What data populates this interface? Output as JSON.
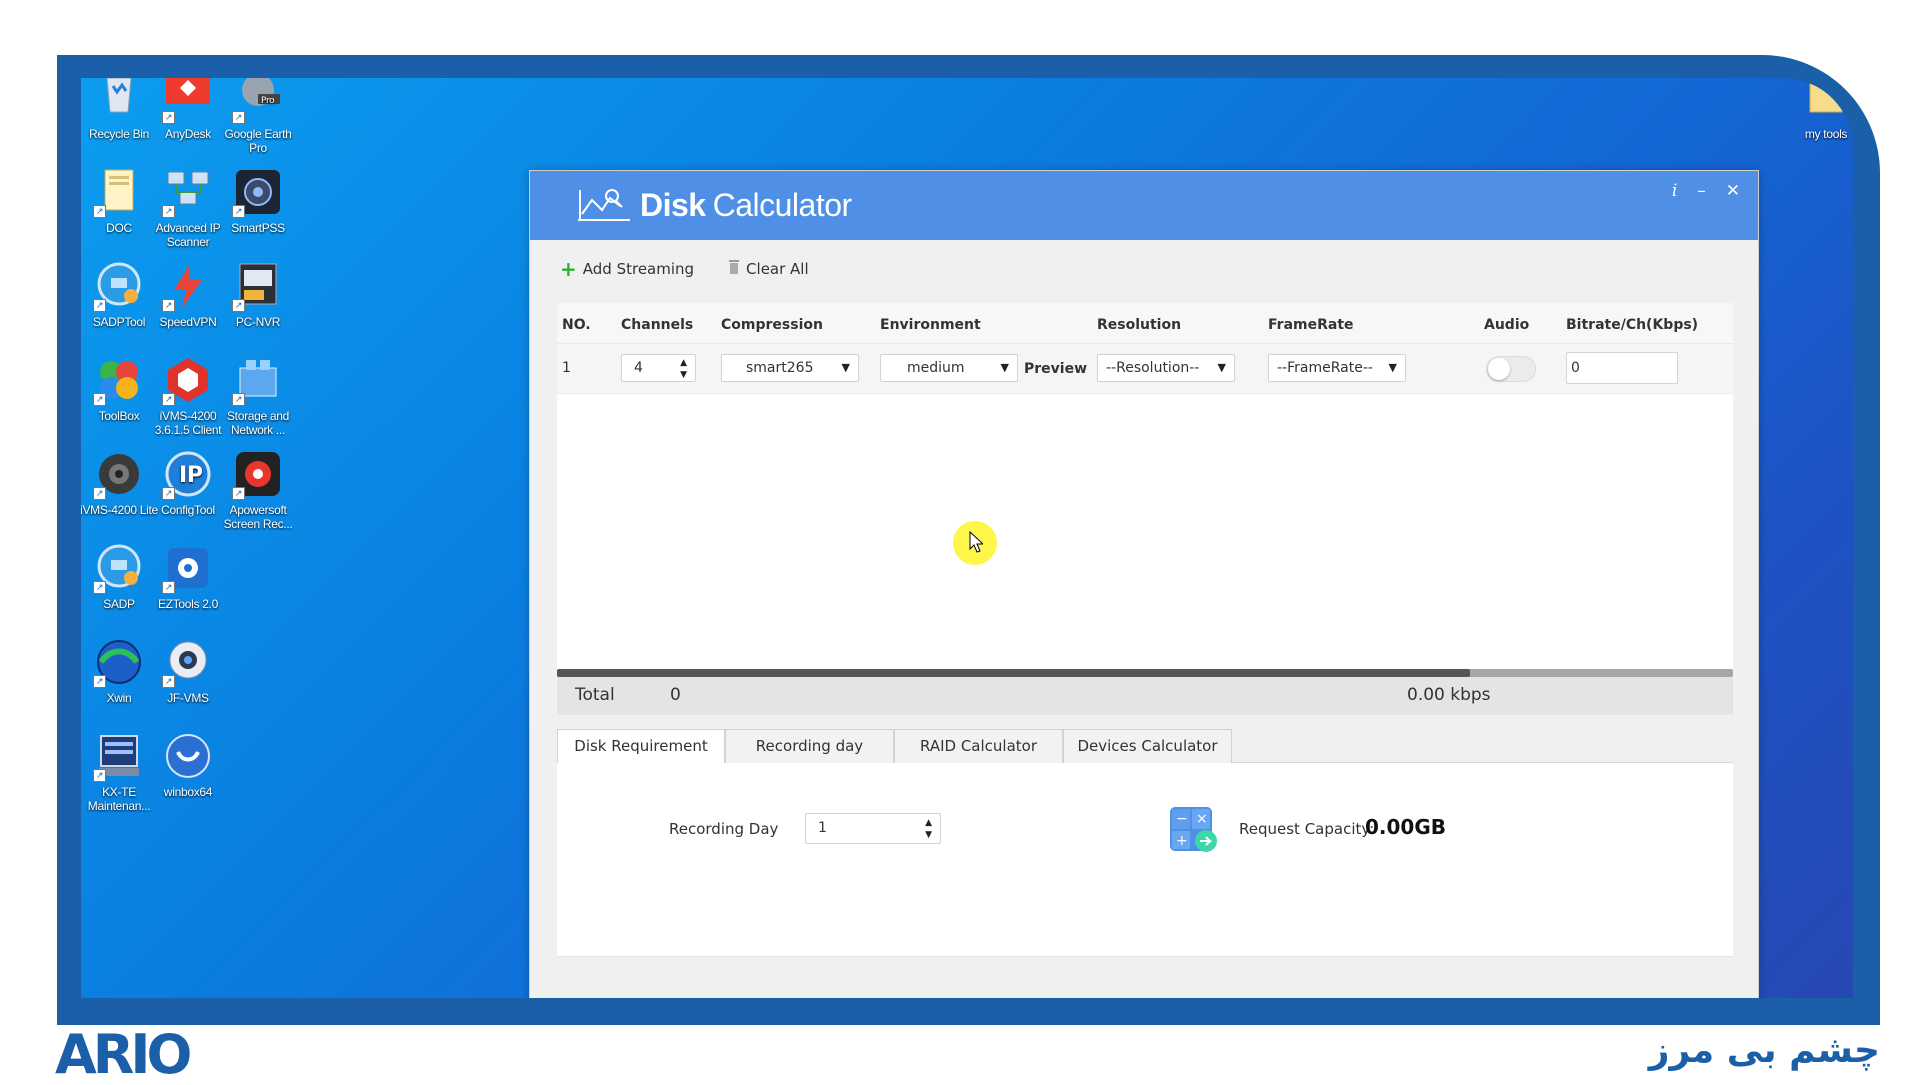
{
  "desktop": {
    "icons": [
      {
        "label": "Recycle Bin",
        "icon": "recycle-bin-icon"
      },
      {
        "label": "AnyDesk",
        "icon": "anydesk-icon"
      },
      {
        "label": "Google Earth Pro",
        "icon": "google-earth-icon",
        "badge": "Pro"
      },
      {
        "label": "DOC",
        "icon": "folder-icon"
      },
      {
        "label": "Advanced IP Scanner",
        "icon": "ip-scanner-icon"
      },
      {
        "label": "SmartPSS",
        "icon": "smartpss-icon"
      },
      {
        "label": "SADPTool",
        "icon": "sadp-tool-icon"
      },
      {
        "label": "SpeedVPN",
        "icon": "speedvpn-icon"
      },
      {
        "label": "PC-NVR",
        "icon": "pc-nvr-icon"
      },
      {
        "label": "ToolBox",
        "icon": "toolbox-icon"
      },
      {
        "label": "iVMS-4200 3.6.1.5 Client",
        "icon": "ivms-client-icon"
      },
      {
        "label": "Storage and Network ...",
        "icon": "storage-network-icon"
      },
      {
        "label": "iVMS-4200 Lite",
        "icon": "ivms-lite-icon"
      },
      {
        "label": "ConfigTool",
        "icon": "config-tool-icon"
      },
      {
        "label": "Apowersoft Screen Rec...",
        "icon": "apowersoft-icon"
      },
      {
        "label": "SADP",
        "icon": "sadp-icon"
      },
      {
        "label": "EZTools 2.0",
        "icon": "eztools-icon"
      },
      {
        "label": "Xwin",
        "icon": "xwin-icon"
      },
      {
        "label": "JF-VMS",
        "icon": "jf-vms-icon"
      },
      {
        "label": "KX-TE Maintenan...",
        "icon": "kx-te-icon"
      },
      {
        "label": "winbox64",
        "icon": "winbox-icon"
      },
      {
        "label": "my tools",
        "icon": "folder-icon"
      }
    ]
  },
  "app": {
    "title_bold": "Disk",
    "title_rest": "Calculator",
    "toolbar": {
      "add": "Add Streaming",
      "clear": "Clear All"
    },
    "columns": [
      "NO.",
      "Channels",
      "Compression",
      "Environment",
      "Resolution",
      "FrameRate",
      "Audio",
      "Bitrate/Ch(Kbps)"
    ],
    "row": {
      "no": "1",
      "channels": "4",
      "compression": "smart265",
      "environment": "medium",
      "preview": "Preview",
      "resolution": "--Resolution--",
      "framerate": "--FrameRate--",
      "bitrate": "0"
    },
    "total": {
      "label": "Total",
      "count": "0",
      "kbps": "0.00 kbps"
    },
    "tabs": [
      "Disk Requirement",
      "Recording day",
      "RAID Calculator",
      "Devices Calculator"
    ],
    "disk_requirement": {
      "recording_day_label": "Recording Day",
      "recording_day_value": "1",
      "request_capacity_label": "Request Capacity:",
      "request_capacity_value": "0.00GB"
    }
  },
  "branding": {
    "logo": "ARIO",
    "slogan": "چشم بی مرز"
  },
  "colors": {
    "frame": "#1b5fa8",
    "titlebar": "#4f8fe6",
    "desktop": "#0a7fe0"
  }
}
